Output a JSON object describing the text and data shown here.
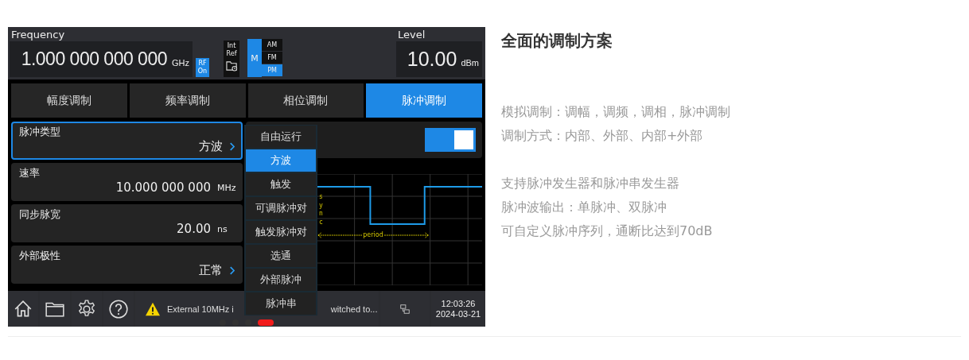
{
  "screen": {
    "frequency": {
      "label": "Frequency",
      "value": "1.000 000 000 000",
      "unit": "GHz"
    },
    "rf_badge": {
      "lines": [
        "RF",
        "On"
      ],
      "on": true
    },
    "ref_badge": {
      "lines": [
        "Int",
        "Ref"
      ]
    },
    "mod_indicator": {
      "text": "M",
      "on": true
    },
    "modulations": [
      {
        "label": "AM",
        "selected": false
      },
      {
        "label": "FM",
        "selected": false
      },
      {
        "label": "PM",
        "selected": true
      }
    ],
    "level": {
      "label": "Level",
      "value": "10.00",
      "unit": "dBm"
    },
    "tabs": [
      {
        "label": "幅度调制",
        "selected": false
      },
      {
        "label": "频率调制",
        "selected": false
      },
      {
        "label": "相位调制",
        "selected": false
      },
      {
        "label": "脉冲调制",
        "selected": true
      }
    ],
    "params": [
      {
        "kind": "menu",
        "label": "脉冲类型",
        "value": "方波",
        "selected": true
      },
      {
        "kind": "number",
        "label": "速率",
        "value": "10.000 000 000",
        "unit": "MHz",
        "selected": false
      },
      {
        "kind": "number",
        "label": "同步脉宽",
        "value": "20.00",
        "unit": "ns",
        "selected": false
      },
      {
        "kind": "menu",
        "label": "外部极性",
        "value": "正常",
        "selected": false
      }
    ],
    "toggle": {
      "on": true
    },
    "waveform": {
      "sync_label": "sync",
      "period_label": "period"
    },
    "dropdown": [
      {
        "label": "自由运行",
        "selected": false
      },
      {
        "label": "方波",
        "selected": true
      },
      {
        "label": "触发",
        "selected": false
      },
      {
        "label": "可调脉冲对",
        "selected": false
      },
      {
        "label": "触发脉冲对",
        "selected": false
      },
      {
        "label": "选通",
        "selected": false
      },
      {
        "label": "外部脉冲",
        "selected": false
      },
      {
        "label": "脉冲串",
        "selected": false
      }
    ],
    "status_bar": {
      "message_parts": [
        "External 10MHz i",
        "witched to..."
      ],
      "time": "12:03:26",
      "date": "2024-03-21"
    },
    "pagination": [
      {
        "selected": false
      },
      {
        "selected": false
      },
      {
        "selected": false
      },
      {
        "selected": true
      }
    ]
  },
  "article": {
    "title": "全面的调制方案",
    "paragraphs": [
      [
        "模拟调制：调幅，调频，调相，脉冲调制",
        "调制方式：内部、外部、内部+外部"
      ],
      [
        "支持脉冲发生器和脉冲串发生器",
        "脉冲波输出：单脉冲、双脉冲",
        "可自定义脉冲序列，通断比达到70dB"
      ]
    ]
  }
}
